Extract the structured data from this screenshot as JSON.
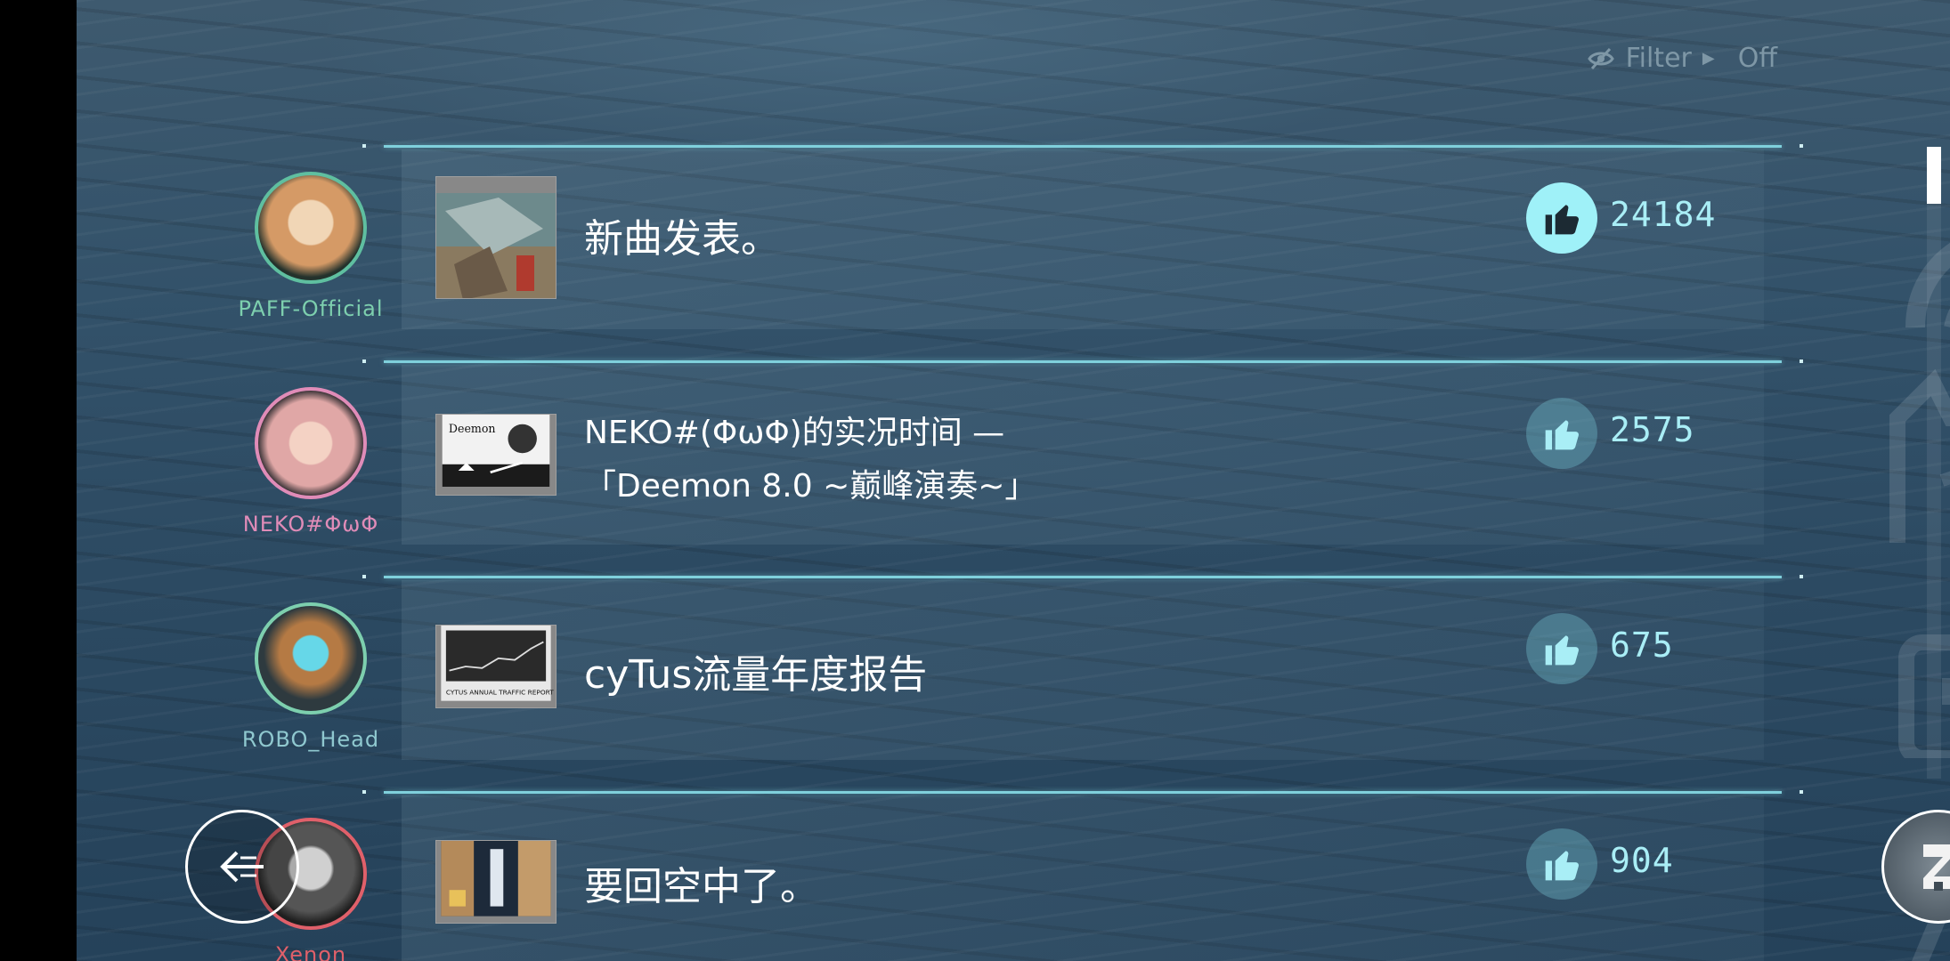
{
  "filter": {
    "label": "Filter",
    "value": "Off",
    "icon": "eye-slash-icon"
  },
  "posts": [
    {
      "author": "PAFF-Official",
      "author_color": "#7dcfae",
      "title_lines": [
        "新曲发表。"
      ],
      "likes": "24184",
      "liked": true
    },
    {
      "author": "NEKO#ΦωΦ",
      "author_color": "#e08cb8",
      "title_lines": [
        "NEKO#(ΦωΦ)的实况时间 —",
        "「Deemon 8.0 ~巅峰演奏~」"
      ],
      "likes": "2575",
      "liked": false
    },
    {
      "author": "ROBO_Head",
      "author_color": "#7dcfae",
      "title_lines": [
        "cyTus流量年度报告"
      ],
      "likes": "675",
      "liked": false
    },
    {
      "author": "Xenon",
      "author_color": "#e0606a",
      "title_lines": [
        "要回空中了。"
      ],
      "likes": "904",
      "liked": false
    }
  ],
  "thumb_caption_3": "CYTUS ANNUAL TRAFFIC REPORT",
  "thumb_caption_2": "Deemon",
  "colors": {
    "accent": "#7fd0dc",
    "like_active": "#9ff1f8",
    "count": "#a9eef6"
  },
  "icons": {
    "back": "back-arrow-icon",
    "menu": "cytus-logo-icon",
    "like": "thumbs-up-icon"
  },
  "scroll": {
    "position_fraction": 0.0
  }
}
